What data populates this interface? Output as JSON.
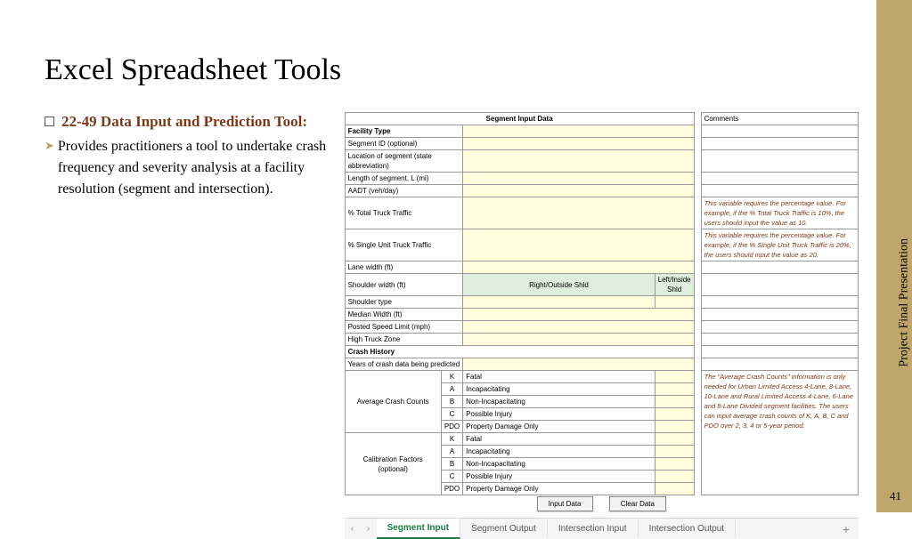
{
  "title": "Excel Spreadsheet Tools",
  "bullet": {
    "heading": "22-49 Data Input and Prediction Tool:",
    "desc": "Provides practitioners a tool to undertake crash frequency and severity analysis at a facility resolution (segment and intersection)."
  },
  "sheet": {
    "header": "Segment Input Data",
    "comments_hdr": "Comments",
    "rows": {
      "facility_type": "Facility Type",
      "segment_id": "Segment ID (optional)",
      "location": "Location of segment (state abbreviation)",
      "length": "Length of segment, L (mi)",
      "aadt": "AADT (veh/day)",
      "pct_total_truck": "% Total Truck Traffic",
      "pct_single_unit": "% Single Unit Truck Traffic",
      "lane_width": "Lane width (ft)",
      "shoulder_width": "Shoulder width (ft)",
      "right_shld": "Right/Outside Shld",
      "left_shld": "Left/Inside Shld",
      "shoulder_type": "Shoulder type",
      "median_width": "Median Width (ft)",
      "posted_speed": "Posted Speed Limit (mph)",
      "high_truck": "High Truck Zone",
      "crash_history": "Crash History",
      "years": "Years of crash data being predicted",
      "avg_crash_counts": "Average Crash Counts",
      "calib_factors": "Calibration Factors (optional)"
    },
    "cats": {
      "K": "K",
      "A": "A",
      "B": "B",
      "C": "C",
      "PDO": "PDO"
    },
    "catlabels": {
      "fatal": "Fatal",
      "incap": "Incapacitating",
      "noninc": "Non-Incapacitating",
      "poss": "Possible Injury",
      "pdo": "Property Damage Only"
    },
    "comments": {
      "truck1": "This variable requires the percentage value. For example, if the % Total Truck Traffic is 10%, the users should input the value as 10.",
      "truck2": "This variable requires the percentage value. For example, if the % Single Unit Truck Traffic is 20%, the users should input the value as 20.",
      "avg": "The \"Average Crash Counts\" information is only needed for Urban Limited Access 4-Lane, 8-Lane, 10-Lane and Rural Limited Access 4-Lane, 6-Lane and 8-Lane Divided segment facilities. The users can input average crash counts of K, A, B, C and PDO over 2, 3, 4 or 5-year period."
    },
    "buttons": {
      "input": "Input Data",
      "clear": "Clear Data"
    },
    "tabs": {
      "seg_in": "Segment Input",
      "seg_out": "Segment Output",
      "int_in": "Intersection Input",
      "int_out": "Intersection Output",
      "plus": "+"
    }
  },
  "sidebar": {
    "label": "Project Final Presentation",
    "page": "41"
  }
}
